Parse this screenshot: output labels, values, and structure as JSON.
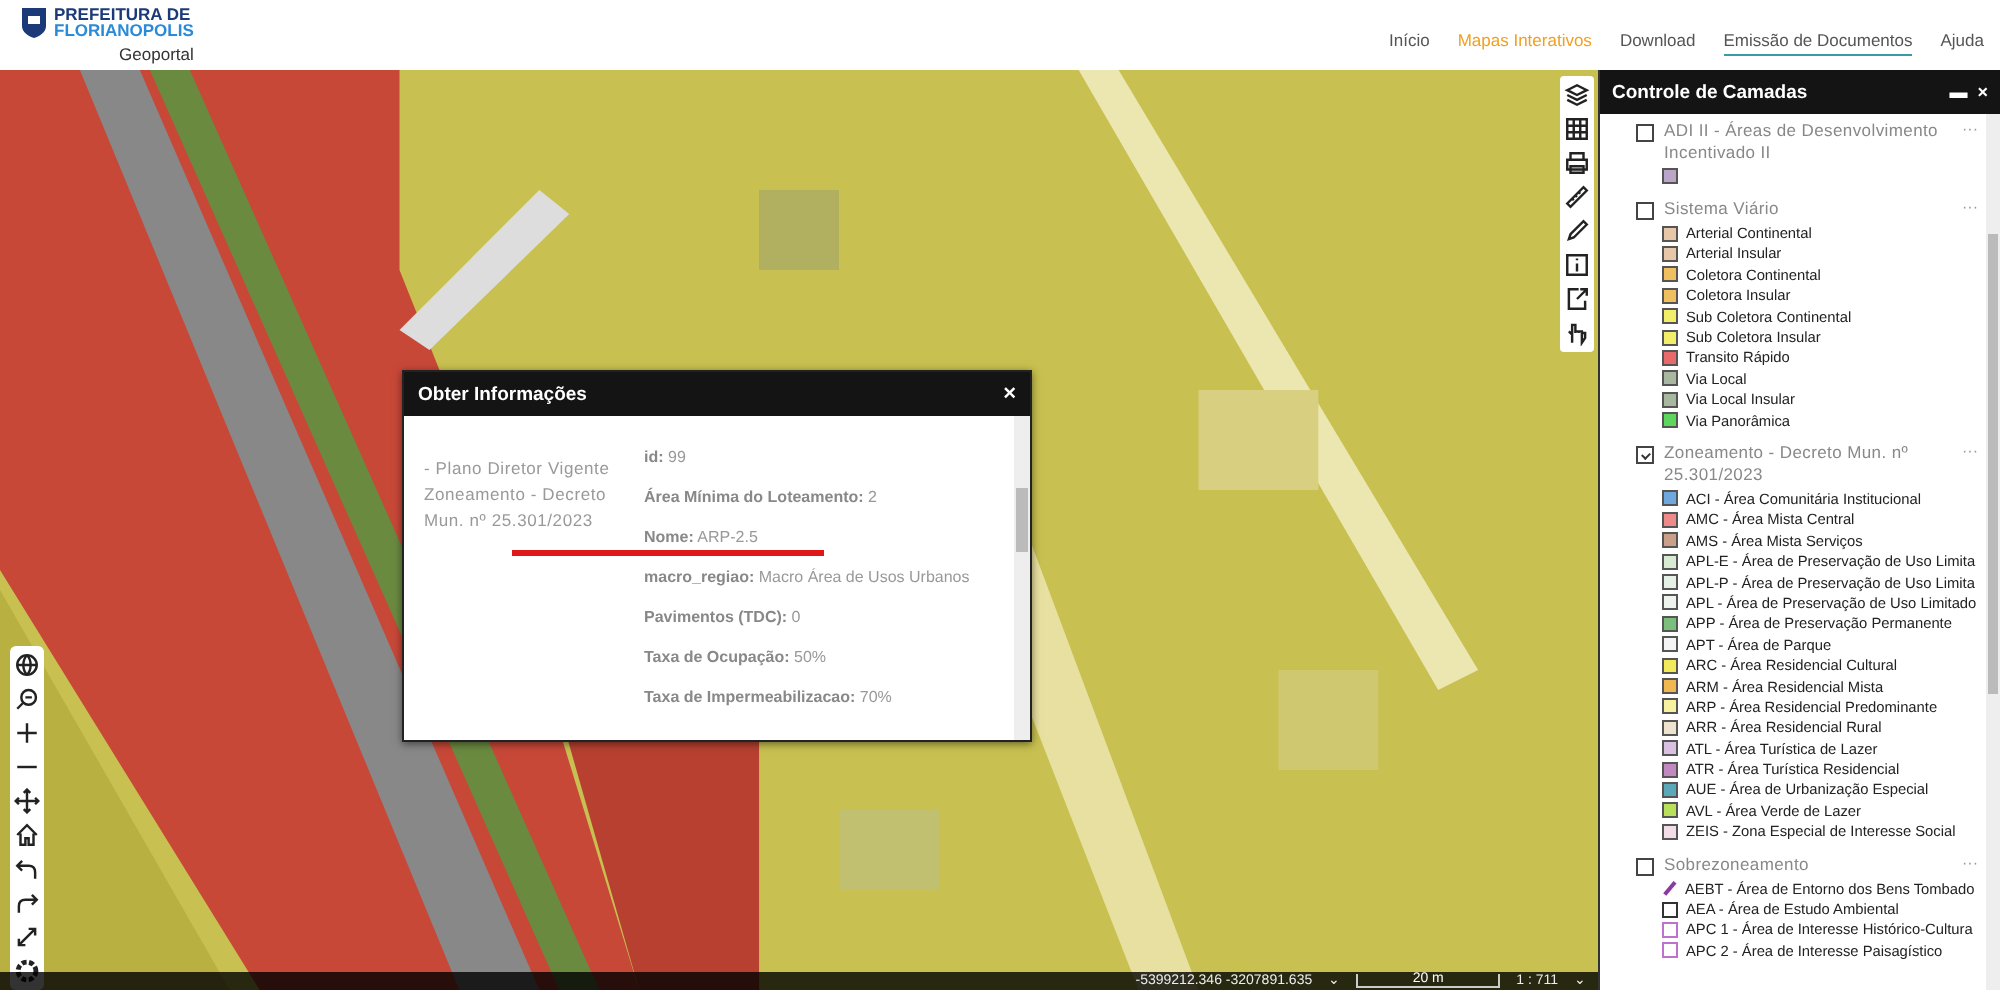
{
  "header": {
    "logo": {
      "line1": "PREFEITURA DE",
      "line2": "FLORIANOPOLIS",
      "subtitle": "Geoportal"
    },
    "nav": [
      {
        "label": "Início",
        "selected": false,
        "highlighted": false
      },
      {
        "label": "Mapas Interativos",
        "selected": false,
        "highlighted": true
      },
      {
        "label": "Download",
        "selected": false,
        "highlighted": false
      },
      {
        "label": "Emissão de Documentos",
        "selected": true,
        "highlighted": false
      },
      {
        "label": "Ajuda",
        "selected": false,
        "highlighted": false
      }
    ]
  },
  "popup": {
    "title": "Obter Informações",
    "close": "×",
    "layer_name": "- Plano Diretor Vigente Zoneamento - Decreto Mun. nº 25.301/2023",
    "fields": [
      {
        "text": "**id:** 99",
        "underlined": false
      },
      {
        "text": "**Área Mínima do Loteamento:** 2",
        "underlined": false
      },
      {
        "text": "**Nome:** ARP-2.5",
        "underlined": true
      },
      {
        "text": "**macro_regiao:** Macro Área de Usos Urbanos",
        "underlined": false
      },
      {
        "text": "**Pavimentos (TDC):** 0",
        "underlined": false
      },
      {
        "text": "**Taxa de Ocupação:** 50%",
        "underlined": false
      },
      {
        "text": "**Taxa de Impermeabilizacao:** 70%",
        "underlined": false
      }
    ]
  },
  "layer_panel": {
    "title": "Controle de Camadas",
    "minimize": "▬",
    "close": "×",
    "layers": [
      {
        "name": "ADI II - Áreas de Desenvolvimento Incentivado II",
        "checked": false,
        "menu": "···",
        "legend": [
          {
            "color": "#b9a6c9",
            "kind": "fill"
          }
        ]
      },
      {
        "name": "Sistema Viário",
        "checked": false,
        "menu": "···",
        "legend": [
          {
            "label": "Arterial Continental",
            "color": "#e8c7a8",
            "kind": "fill"
          },
          {
            "label": "Arterial Insular",
            "color": "#e8c7a8",
            "kind": "fill"
          },
          {
            "label": "Coletora Continental",
            "color": "#f0c060",
            "kind": "fill"
          },
          {
            "label": "Coletora Insular",
            "color": "#f0c060",
            "kind": "fill"
          },
          {
            "label": "Sub Coletora Continental",
            "color": "#f2ee6a",
            "kind": "fill"
          },
          {
            "label": "Sub Coletora Insular",
            "color": "#f2ee6a",
            "kind": "fill"
          },
          {
            "label": "Transito Rápido",
            "color": "#e86a6a",
            "kind": "fill"
          },
          {
            "label": "Via Local",
            "color": "#a8b8a0",
            "kind": "fill"
          },
          {
            "label": "Via Local Insular",
            "color": "#a8b8a0",
            "kind": "fill"
          },
          {
            "label": "Via Panorâmica",
            "color": "#5cd65c",
            "kind": "fill"
          }
        ]
      },
      {
        "name": "Zoneamento - Decreto Mun. nº 25.301/2023",
        "checked": true,
        "menu": "···",
        "legend": [
          {
            "label": "ACI - Área Comunitária Institucional",
            "color": "#6fa8dc",
            "kind": "fill"
          },
          {
            "label": "AMC - Área Mista Central",
            "color": "#ee8a8a",
            "kind": "fill"
          },
          {
            "label": "AMS - Área Mista Serviços",
            "color": "#c9a08a",
            "kind": "fill"
          },
          {
            "label": "APL-E - Área de Preservação de Uso Limita",
            "color": "#d9ead3",
            "kind": "fill"
          },
          {
            "label": "APL-P - Área de Preservação de Uso Limita",
            "color": "#e6f0e6",
            "kind": "fill"
          },
          {
            "label": "APL - Área de Preservação de Uso Limitado",
            "color": "#eef3ee",
            "kind": "fill"
          },
          {
            "label": "APP - Área de Preservação Permanente",
            "color": "#7cbf7c",
            "kind": "fill"
          },
          {
            "label": "APT - Área de Parque",
            "color": "#f4f4f4",
            "kind": "fill"
          },
          {
            "label": "ARC - Área Residencial Cultural",
            "color": "#f2ea5a",
            "kind": "fill"
          },
          {
            "label": "ARM - Área Residencial Mista",
            "color": "#f0b850",
            "kind": "fill"
          },
          {
            "label": "ARP - Área Residencial Predominante",
            "color": "#f8f2a0",
            "kind": "fill"
          },
          {
            "label": "ARR - Área Residencial Rural",
            "color": "#ede3cf",
            "kind": "fill"
          },
          {
            "label": "ATL - Área Turística de Lazer",
            "color": "#d8c0e0",
            "kind": "fill"
          },
          {
            "label": "ATR - Área Turística Residencial",
            "color": "#c08ac0",
            "kind": "fill"
          },
          {
            "label": "AUE - Área de Urbanização Especial",
            "color": "#5aa8b8",
            "kind": "fill"
          },
          {
            "label": "AVL - Área Verde de Lazer",
            "color": "#b8e05a",
            "kind": "fill"
          },
          {
            "label": "ZEIS - Zona Especial de Interesse Social",
            "color": "#f0dde8",
            "kind": "fill"
          }
        ]
      },
      {
        "name": "Sobrezoneamento",
        "checked": false,
        "menu": "···",
        "legend": [
          {
            "label": "AEBT - Área de Entorno dos Bens Tombado",
            "color": "#8a3aa0",
            "kind": "line"
          },
          {
            "label": "AEA - Área de Estudo Ambiental",
            "color": "#333333",
            "kind": "outline"
          },
          {
            "label": "APC 1 - Área de Interesse Histórico-Cultura",
            "color": "#c070d0",
            "kind": "outline"
          },
          {
            "label": "APC 2 - Área de Interesse Paisagístico",
            "color": "#c070d0",
            "kind": "outline"
          }
        ]
      }
    ]
  },
  "status_bar": {
    "coordinates": "-5399212.346 -3207891.635",
    "coord_toggle": "⌄",
    "scale_label": "20 m",
    "scale_ratio": "1 : 711",
    "ratio_toggle": "⌄"
  }
}
